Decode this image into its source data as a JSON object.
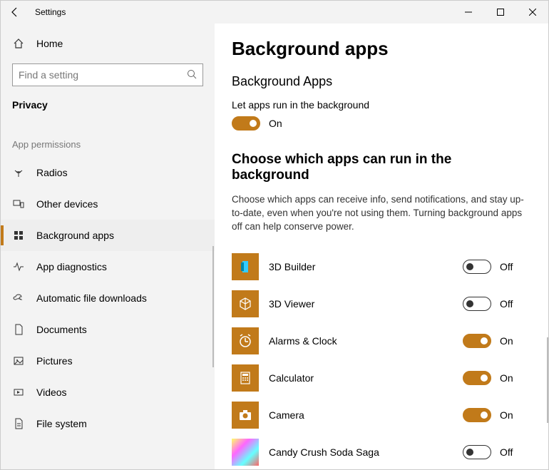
{
  "window": {
    "title": "Settings"
  },
  "sidebar": {
    "home_label": "Home",
    "search_placeholder": "Find a setting",
    "section": "Privacy",
    "group": "App permissions",
    "items": [
      {
        "label": "Radios",
        "icon": "radios"
      },
      {
        "label": "Other devices",
        "icon": "other-devices"
      },
      {
        "label": "Background apps",
        "icon": "background-apps",
        "active": true
      },
      {
        "label": "App diagnostics",
        "icon": "diagnostics"
      },
      {
        "label": "Automatic file downloads",
        "icon": "downloads"
      },
      {
        "label": "Documents",
        "icon": "documents"
      },
      {
        "label": "Pictures",
        "icon": "pictures"
      },
      {
        "label": "Videos",
        "icon": "videos"
      },
      {
        "label": "File system",
        "icon": "filesystem"
      }
    ]
  },
  "content": {
    "page_title": "Background apps",
    "section1_title": "Background Apps",
    "master_label": "Let apps run in the background",
    "master_state_label": "On",
    "master_state": true,
    "section2_title": "Choose which apps can run in the background",
    "description": "Choose which apps can receive info, send notifications, and stay up-to-date, even when you're not using them. Turning background apps off can help conserve power.",
    "apps": [
      {
        "name": "3D Builder",
        "state": false,
        "state_label": "Off",
        "icon": "3d-builder"
      },
      {
        "name": "3D Viewer",
        "state": false,
        "state_label": "Off",
        "icon": "3d-viewer"
      },
      {
        "name": "Alarms & Clock",
        "state": true,
        "state_label": "On",
        "icon": "alarms"
      },
      {
        "name": "Calculator",
        "state": true,
        "state_label": "On",
        "icon": "calculator"
      },
      {
        "name": "Camera",
        "state": true,
        "state_label": "On",
        "icon": "camera"
      },
      {
        "name": "Candy Crush Soda Saga",
        "state": false,
        "state_label": "Off",
        "icon": "candy-crush"
      }
    ]
  }
}
